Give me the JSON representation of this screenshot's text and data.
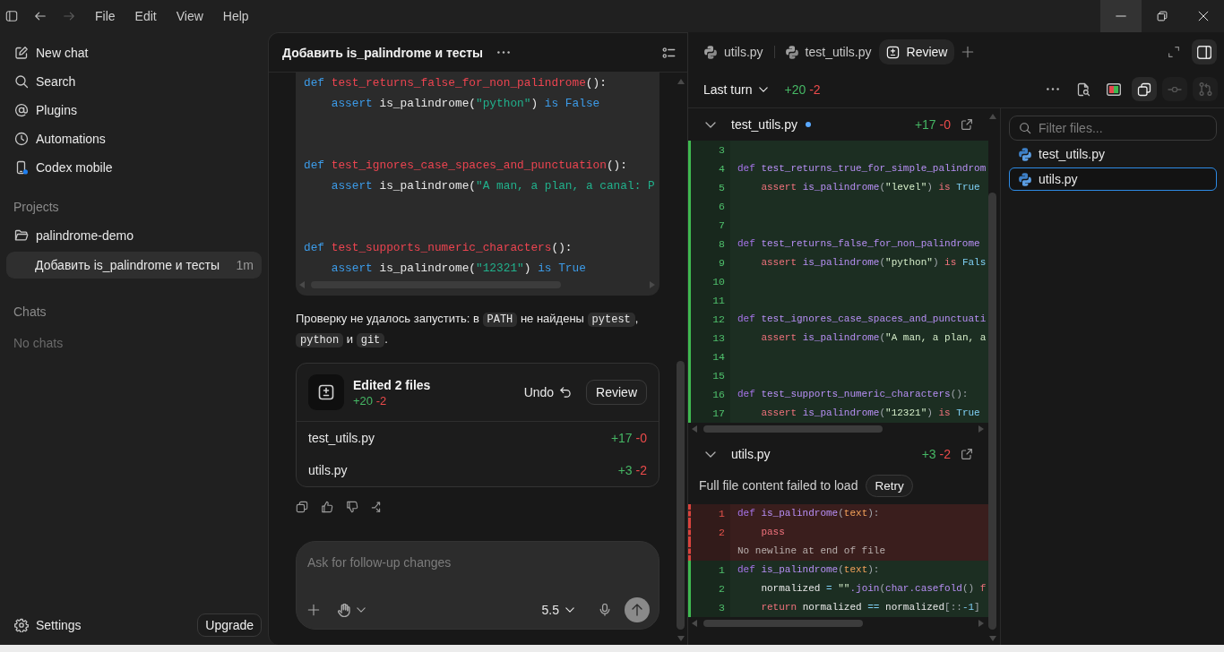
{
  "titlebar": {
    "nav": [
      {
        "kind": "back",
        "disabled": false
      },
      {
        "kind": "forward",
        "disabled": true
      }
    ],
    "menus": [
      "File",
      "Edit",
      "View",
      "Help"
    ],
    "window_controls": [
      {
        "kind": "minimize",
        "hovered": true
      },
      {
        "kind": "maximize",
        "hovered": false
      },
      {
        "kind": "close",
        "hovered": false
      }
    ]
  },
  "sidebar": {
    "nav": [
      {
        "kind": "new-chat",
        "label": "New chat",
        "notification": false
      },
      {
        "kind": "search",
        "label": "Search",
        "notification": false
      },
      {
        "kind": "plugins",
        "label": "Plugins",
        "notification": false
      },
      {
        "kind": "automations",
        "label": "Automations",
        "notification": false
      },
      {
        "kind": "mobile",
        "label": "Codex mobile",
        "notification": true
      }
    ],
    "projects_label": "Projects",
    "projects": [
      {
        "name": "palindrome-demo",
        "threads": [
          {
            "title": "Добавить is_palindrome и тесты",
            "age": "1m",
            "selected": true
          }
        ]
      }
    ],
    "chats_label": "Chats",
    "chats_empty": "No chats",
    "settings": "Settings",
    "upgrade": "Upgrade"
  },
  "thread": {
    "title": "Добавить is_palindrome и тесты",
    "code_block": {
      "groups": [
        [
          [
            {
              "kind": "keyword",
              "text": "def "
            },
            {
              "kind": "name",
              "text": "test_returns_false_for_non_palindrome"
            },
            {
              "kind": "punct",
              "text": "():"
            }
          ],
          [
            {
              "kind": "statement",
              "text": "    assert "
            },
            {
              "kind": "call",
              "text": "is_palindrome"
            },
            {
              "kind": "punct",
              "text": "("
            },
            {
              "kind": "string",
              "text": "\"python\""
            },
            {
              "kind": "punct",
              "text": ") "
            },
            {
              "kind": "statement",
              "text": "is "
            },
            {
              "kind": "constant",
              "text": "False"
            }
          ]
        ],
        [
          [
            {
              "kind": "keyword",
              "text": "def "
            },
            {
              "kind": "name",
              "text": "test_ignores_case_spaces_and_punctuation"
            },
            {
              "kind": "punct",
              "text": "():"
            }
          ],
          [
            {
              "kind": "statement",
              "text": "    assert "
            },
            {
              "kind": "call",
              "text": "is_palindrome"
            },
            {
              "kind": "punct",
              "text": "("
            },
            {
              "kind": "string",
              "text": "\"A man, a plan, a canal: P"
            }
          ]
        ],
        [
          [
            {
              "kind": "keyword",
              "text": "def "
            },
            {
              "kind": "name",
              "text": "test_supports_numeric_characters"
            },
            {
              "kind": "punct",
              "text": "():"
            }
          ],
          [
            {
              "kind": "statement",
              "text": "    assert "
            },
            {
              "kind": "call",
              "text": "is_palindrome"
            },
            {
              "kind": "punct",
              "text": "("
            },
            {
              "kind": "string",
              "text": "\"12321\""
            },
            {
              "kind": "punct",
              "text": ") "
            },
            {
              "kind": "statement",
              "text": "is "
            },
            {
              "kind": "constant",
              "text": "True"
            }
          ]
        ]
      ]
    },
    "message": [
      {
        "kind": "text",
        "text": "Проверку не удалось запустить: в "
      },
      {
        "kind": "code",
        "text": "PATH"
      },
      {
        "kind": "text",
        "text": " не найдены "
      },
      {
        "kind": "code",
        "text": "pytest"
      },
      {
        "kind": "text",
        "text": ", "
      },
      {
        "kind": "code",
        "text": "python"
      },
      {
        "kind": "text",
        "text": " и "
      },
      {
        "kind": "code",
        "text": "git"
      },
      {
        "kind": "text",
        "text": "."
      }
    ],
    "edit_card": {
      "title": "Edited 2 files",
      "added": "+20",
      "removed": "-2",
      "undo": "Undo",
      "review": "Review",
      "files": [
        {
          "name": "test_utils.py",
          "added": "+17",
          "removed": "-0"
        },
        {
          "name": "utils.py",
          "added": "+3",
          "removed": "-2"
        }
      ]
    },
    "composer": {
      "placeholder": "Ask for follow-up changes",
      "model": "5.5",
      "send_disabled": true
    }
  },
  "review": {
    "tabs": [
      {
        "kind": "file",
        "label": "utils.py",
        "selected": false
      },
      {
        "kind": "file",
        "label": "test_utils.py",
        "selected": false
      },
      {
        "kind": "review",
        "label": "Review",
        "selected": true
      }
    ],
    "scope": "Last turn",
    "added": "+20",
    "removed": "-2",
    "tools": [
      {
        "kind": "more",
        "active": false,
        "disabled": false
      },
      {
        "kind": "find-in-file",
        "active": false,
        "disabled": false
      },
      {
        "kind": "split-view",
        "active": false,
        "disabled": false
      },
      {
        "kind": "copy",
        "active": true,
        "disabled": false
      },
      {
        "kind": "commit",
        "active": false,
        "disabled": true
      },
      {
        "kind": "pull-request",
        "active": false,
        "disabled": true
      }
    ],
    "files": [
      {
        "name": "test_utils.py",
        "unsaved": true,
        "expanded": true,
        "added": "+17",
        "removed": "-0",
        "lines": [
          {
            "kind": "code",
            "number": "3",
            "deleted": false
          },
          {
            "kind": "code",
            "number": "4",
            "deleted": false,
            "tokens": [
              {
                "kind": "keyword",
                "text": "def "
              },
              {
                "kind": "name",
                "text": "test_returns_true_for_simple_palindrom"
              }
            ]
          },
          {
            "kind": "code",
            "number": "5",
            "deleted": false,
            "tokens": [
              {
                "kind": "statement",
                "text": "    assert "
              },
              {
                "kind": "call",
                "text": "is_palindrome"
              },
              {
                "kind": "punct",
                "text": "("
              },
              {
                "kind": "string",
                "text": "\"level\""
              },
              {
                "kind": "punct",
                "text": ") "
              },
              {
                "kind": "statement",
                "text": "is "
              },
              {
                "kind": "constant",
                "text": "True"
              }
            ]
          },
          {
            "kind": "code",
            "number": "6",
            "deleted": false
          },
          {
            "kind": "code",
            "number": "7",
            "deleted": false
          },
          {
            "kind": "code",
            "number": "8",
            "deleted": false,
            "tokens": [
              {
                "kind": "keyword",
                "text": "def "
              },
              {
                "kind": "name",
                "text": "test_returns_false_for_non_palindrome"
              }
            ]
          },
          {
            "kind": "code",
            "number": "9",
            "deleted": false,
            "tokens": [
              {
                "kind": "statement",
                "text": "    assert "
              },
              {
                "kind": "call",
                "text": "is_palindrome"
              },
              {
                "kind": "punct",
                "text": "("
              },
              {
                "kind": "string",
                "text": "\"python\""
              },
              {
                "kind": "punct",
                "text": ") "
              },
              {
                "kind": "statement",
                "text": "is "
              },
              {
                "kind": "constant",
                "text": "Fals"
              }
            ]
          },
          {
            "kind": "code",
            "number": "10",
            "deleted": false
          },
          {
            "kind": "code",
            "number": "11",
            "deleted": false
          },
          {
            "kind": "code",
            "number": "12",
            "deleted": false,
            "tokens": [
              {
                "kind": "keyword",
                "text": "def "
              },
              {
                "kind": "name",
                "text": "test_ignores_case_spaces_and_punctuati"
              }
            ]
          },
          {
            "kind": "code",
            "number": "13",
            "deleted": false,
            "tokens": [
              {
                "kind": "statement",
                "text": "    assert "
              },
              {
                "kind": "call",
                "text": "is_palindrome"
              },
              {
                "kind": "punct",
                "text": "("
              },
              {
                "kind": "string",
                "text": "\"A man, a plan, a"
              }
            ]
          },
          {
            "kind": "code",
            "number": "14",
            "deleted": false
          },
          {
            "kind": "code",
            "number": "15",
            "deleted": false
          },
          {
            "kind": "code",
            "number": "16",
            "deleted": false,
            "tokens": [
              {
                "kind": "keyword",
                "text": "def "
              },
              {
                "kind": "name",
                "text": "test_supports_numeric_characters"
              },
              {
                "kind": "punct",
                "text": "():"
              }
            ]
          },
          {
            "kind": "code",
            "number": "17",
            "deleted": false,
            "tokens": [
              {
                "kind": "statement",
                "text": "    assert "
              },
              {
                "kind": "call",
                "text": "is_palindrome"
              },
              {
                "kind": "punct",
                "text": "("
              },
              {
                "kind": "string",
                "text": "\"12321\""
              },
              {
                "kind": "punct",
                "text": ") "
              },
              {
                "kind": "statement",
                "text": "is "
              },
              {
                "kind": "constant",
                "text": "True"
              }
            ]
          }
        ]
      },
      {
        "name": "utils.py",
        "unsaved": false,
        "expanded": true,
        "added": "+3",
        "removed": "-2",
        "notice": "Full file content failed to load",
        "retry": "Retry",
        "lines": [
          {
            "kind": "code",
            "number": "1",
            "deleted": true,
            "tokens": [
              {
                "kind": "keyword",
                "text": "def "
              },
              {
                "kind": "call",
                "text": "is_palindrome"
              },
              {
                "kind": "punct",
                "text": "("
              },
              {
                "kind": "param",
                "text": "text"
              },
              {
                "kind": "punct",
                "text": "):"
              }
            ]
          },
          {
            "kind": "code",
            "number": "2",
            "deleted": true,
            "tokens": [
              {
                "kind": "statement",
                "text": "    pass"
              }
            ]
          },
          {
            "kind": "note",
            "deleted": true,
            "text": "No newline at end of file"
          },
          {
            "kind": "code",
            "number": "1",
            "deleted": false,
            "tokens": [
              {
                "kind": "keyword",
                "text": "def "
              },
              {
                "kind": "call",
                "text": "is_palindrome"
              },
              {
                "kind": "punct",
                "text": "("
              },
              {
                "kind": "param",
                "text": "text"
              },
              {
                "kind": "punct",
                "text": "):"
              }
            ]
          },
          {
            "kind": "code",
            "number": "2",
            "deleted": false,
            "tokens": [
              {
                "kind": "plain",
                "text": "    normalized "
              },
              {
                "kind": "operator",
                "text": "= "
              },
              {
                "kind": "string",
                "text": "\"\""
              },
              {
                "kind": "call",
                "text": ".join"
              },
              {
                "kind": "punct",
                "text": "("
              },
              {
                "kind": "call",
                "text": "char.casefold"
              },
              {
                "kind": "punct",
                "text": "() "
              },
              {
                "kind": "statement",
                "text": "f"
              }
            ]
          },
          {
            "kind": "code",
            "number": "3",
            "deleted": false,
            "tokens": [
              {
                "kind": "statement",
                "text": "    return "
              },
              {
                "kind": "plain",
                "text": "normalized "
              },
              {
                "kind": "operator",
                "text": "== "
              },
              {
                "kind": "plain",
                "text": "normalized"
              },
              {
                "kind": "punct",
                "text": "[::"
              },
              {
                "kind": "constant",
                "text": "-1"
              },
              {
                "kind": "punct",
                "text": "]"
              }
            ]
          }
        ]
      }
    ],
    "filter": {
      "placeholder": "Filter files..."
    },
    "file_list": [
      {
        "name": "test_utils.py",
        "selected": false
      },
      {
        "name": "utils.py",
        "selected": true
      }
    ]
  }
}
